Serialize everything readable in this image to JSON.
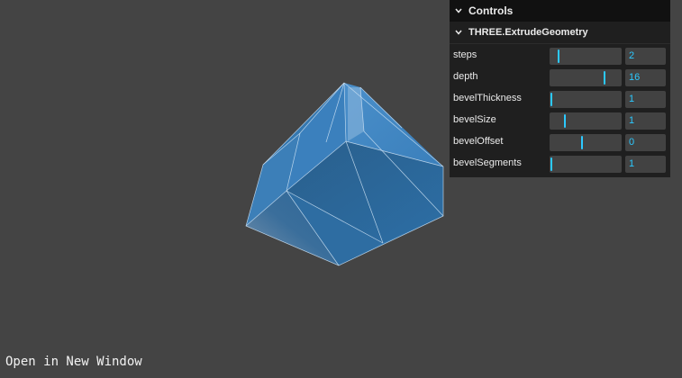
{
  "panel": {
    "title": "Controls",
    "folder_title": "THREE.ExtrudeGeometry"
  },
  "controls": [
    {
      "label": "steps",
      "value": "2",
      "fill": 0.1
    },
    {
      "label": "depth",
      "value": "16",
      "fill": 0.78
    },
    {
      "label": "bevelThickness",
      "value": "1",
      "fill": 0.0
    },
    {
      "label": "bevelSize",
      "value": "1",
      "fill": 0.2
    },
    {
      "label": "bevelOffset",
      "value": "0",
      "fill": 0.45
    },
    {
      "label": "bevelSegments",
      "value": "1",
      "fill": 0.0
    }
  ],
  "footer": {
    "link_text": "Open in New Window"
  },
  "colors": {
    "background": "#444444",
    "accent": "#2cc9ff",
    "mesh": "#3a7fb8"
  },
  "icons": {
    "collapse": "chevron-down-icon"
  }
}
